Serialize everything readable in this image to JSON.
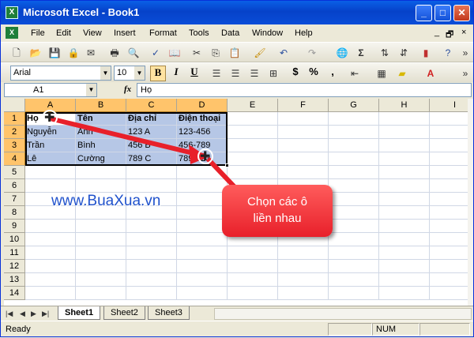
{
  "window": {
    "title": "Microsoft Excel - Book1",
    "buttons": {
      "minimize": "_",
      "maximize": "□",
      "close": "✕"
    }
  },
  "menu": {
    "items": [
      "File",
      "Edit",
      "View",
      "Insert",
      "Format",
      "Tools",
      "Data",
      "Window",
      "Help"
    ],
    "right": {
      "minimize": "_",
      "restore": "🗗",
      "close": "×"
    }
  },
  "format_toolbar": {
    "font": "Arial",
    "size": "10",
    "bold": "B",
    "italic": "I",
    "underline": "U",
    "currency": "$",
    "percent": "%",
    "comma": ","
  },
  "formula_bar": {
    "name_box": "A1",
    "fx": "fx",
    "content": "Họ"
  },
  "columns": [
    "A",
    "B",
    "C",
    "D",
    "E",
    "F",
    "G",
    "H",
    "I"
  ],
  "rows": [
    "1",
    "2",
    "3",
    "4",
    "5",
    "6",
    "7",
    "8",
    "9",
    "10",
    "11",
    "12",
    "13",
    "14"
  ],
  "cells": {
    "A1": "Họ",
    "B1": "Tên",
    "C1": "Địa chỉ",
    "D1": "Điện thoại",
    "A2": "Nguyễn",
    "B2": "Anh",
    "C2": "123 A",
    "D2": "123-456",
    "A3": "Trần",
    "B3": "Bình",
    "C3": "456 B",
    "D3": "456-789",
    "A4": "Lê",
    "B4": "Cường",
    "C4": "789 C",
    "D4": "789-123"
  },
  "watermark": "www.BuaXua.vn",
  "callout": {
    "line1": "Chọn các ô",
    "line2": "liền nhau"
  },
  "sheets": [
    "Sheet1",
    "Sheet2",
    "Sheet3"
  ],
  "active_sheet": "Sheet1",
  "status": {
    "text": "Ready",
    "num": "NUM"
  },
  "colors": {
    "selection": "#b6c7e6",
    "header_highlight": "#ffc46b",
    "callout": "#e8202a",
    "arrow": "#e8202a",
    "title_bar": "#0a4dd8"
  }
}
